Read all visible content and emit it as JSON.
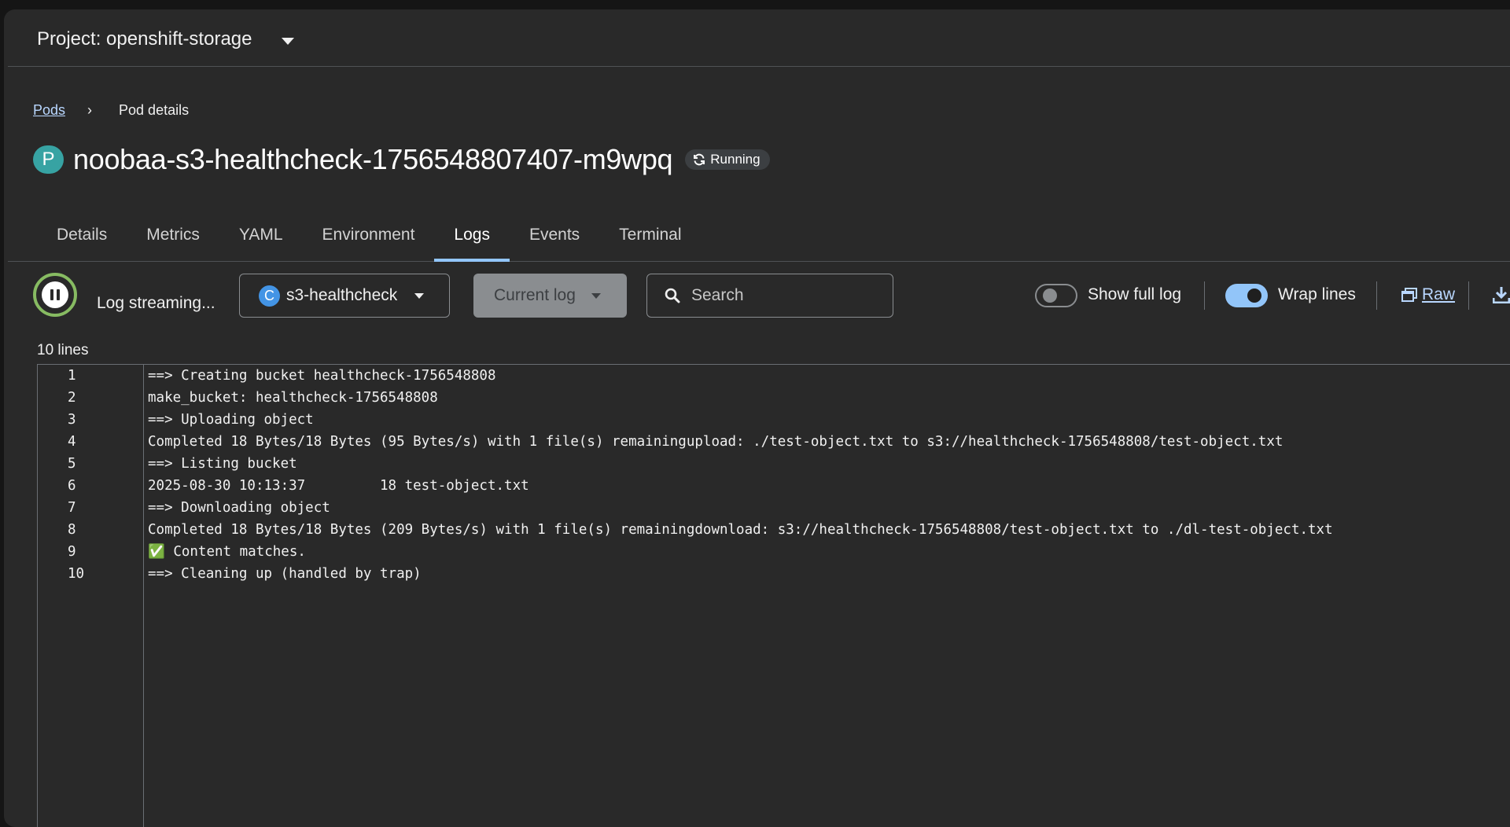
{
  "project": {
    "label": "Project: openshift-storage"
  },
  "breadcrumb": {
    "parent": "Pods",
    "current": "Pod details"
  },
  "pod": {
    "badge": "P",
    "name": "noobaa-s3-healthcheck-1756548807407-m9wpq",
    "status": "Running"
  },
  "tabs": [
    "Details",
    "Metrics",
    "YAML",
    "Environment",
    "Logs",
    "Events",
    "Terminal"
  ],
  "active_tab": "Logs",
  "toolbar": {
    "streaming_label": "Log streaming...",
    "container_badge": "C",
    "container": "s3-healthcheck",
    "log_type": "Current log",
    "search_placeholder": "Search",
    "show_full_log_label": "Show full log",
    "show_full_log": false,
    "wrap_lines_label": "Wrap lines",
    "wrap_lines": true,
    "raw_label": "Raw"
  },
  "log": {
    "count_label": "10 lines",
    "lines": [
      {
        "no": "1",
        "text": "==> Creating bucket healthcheck-1756548808"
      },
      {
        "no": "2",
        "text": "make_bucket: healthcheck-1756548808"
      },
      {
        "no": "3",
        "text": "==> Uploading object"
      },
      {
        "no": "4",
        "text": "Completed 18 Bytes/18 Bytes (95 Bytes/s) with 1 file(s) remainingupload: ./test-object.txt to s3://healthcheck-1756548808/test-object.txt"
      },
      {
        "no": "5",
        "text": "==> Listing bucket"
      },
      {
        "no": "6",
        "text": "2025-08-30 10:13:37         18 test-object.txt"
      },
      {
        "no": "7",
        "text": "==> Downloading object"
      },
      {
        "no": "8",
        "text": "Completed 18 Bytes/18 Bytes (209 Bytes/s) with 1 file(s) remainingdownload: s3://healthcheck-1756548808/test-object.txt to ./dl-test-object.txt"
      },
      {
        "no": "9",
        "text": "✅ Content matches."
      },
      {
        "no": "10",
        "text": "==> Cleaning up (handled by trap)"
      }
    ]
  },
  "colors": {
    "accent": "#92c5f9",
    "link": "#b9d7ff",
    "streaming_ring": "#87bb62",
    "pod_badge": "#37a3a3",
    "container_badge": "#4394e5"
  }
}
